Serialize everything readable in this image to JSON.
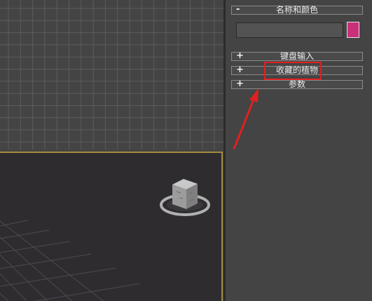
{
  "panel": {
    "name_and_color": {
      "sign": "-",
      "label": "名称和颜色",
      "swatch_color": "#c8307a"
    },
    "rollouts": [
      {
        "sign": "+",
        "label": "键盘输入"
      },
      {
        "sign": "+",
        "label": "收藏的植物"
      },
      {
        "sign": "+",
        "label": "参数"
      }
    ]
  },
  "annotation": {
    "highlight_color": "#e02020",
    "target": "收藏的植物"
  }
}
